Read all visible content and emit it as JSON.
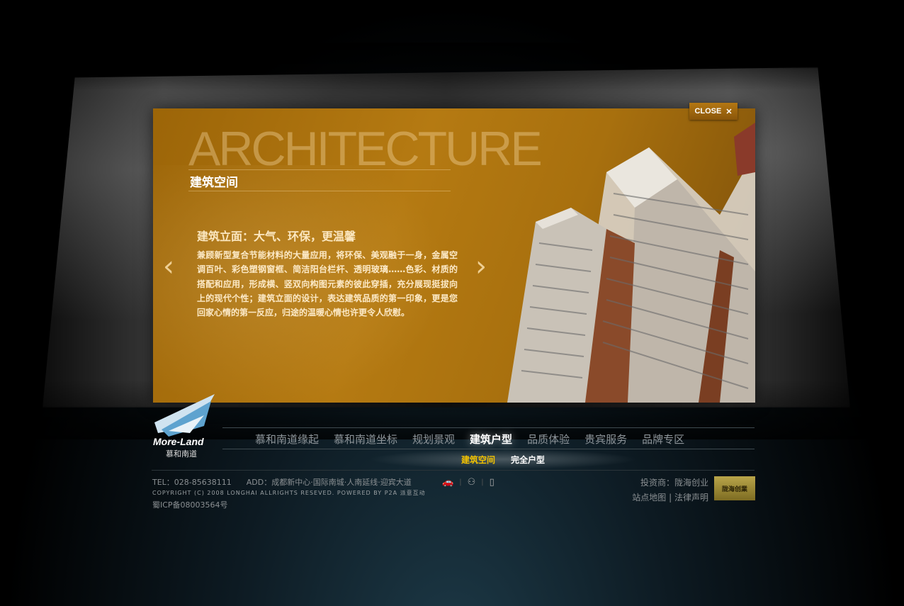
{
  "panel": {
    "big_word": "ARCHITECTURE",
    "subtitle": "建筑空间",
    "heading": "建筑立面：大气、环保，更温馨",
    "body": "兼顾新型复合节能材料的大量应用，将环保、美观融于一身，金属空调百叶、彩色塑钢窗框、简洁阳台栏杆、透明玻璃……色彩、材质的搭配和应用，形成横、竖双向构图元素的彼此穿插，充分展现挺拔向上的现代个性；建筑立面的设计，表达建筑品质的第一印象，更是您回家心情的第一反应，归途的温暖心情也许更令人欣慰。",
    "prev_icon": "chevron-left-icon",
    "next_icon": "chevron-right-icon"
  },
  "close": {
    "label": "CLOSE",
    "icon": "close-icon"
  },
  "logo": {
    "name": "More-Land",
    "cn": "慕和南道"
  },
  "nav": {
    "items": [
      "慕和南道缘起",
      "慕和南道坐标",
      "规划景观",
      "建筑户型",
      "品质体验",
      "贵宾服务",
      "品牌专区"
    ],
    "active": "建筑户型"
  },
  "subnav": {
    "items": [
      "建筑空间",
      "完全户型"
    ],
    "active": "建筑空间"
  },
  "footer": {
    "tel": "TEL：028-85638111",
    "addr": "ADD：成都新中心·国际南城·人南延线·迎宾大道",
    "copyright": "COPYRIGHT (C) 2008 LONGHAI ALLRIGHTS RESEVED. POWERED BY P2A 派意互动",
    "icp": "蜀ICP备08003564号",
    "investor": "投资商：陇海创业",
    "sitemap": "站点地图",
    "legal": "法律声明",
    "divider": "|",
    "badge": "陇海创業",
    "accent": "#f2c200"
  },
  "icons": [
    "car-icon",
    "share-icon",
    "bookmark-icon"
  ]
}
